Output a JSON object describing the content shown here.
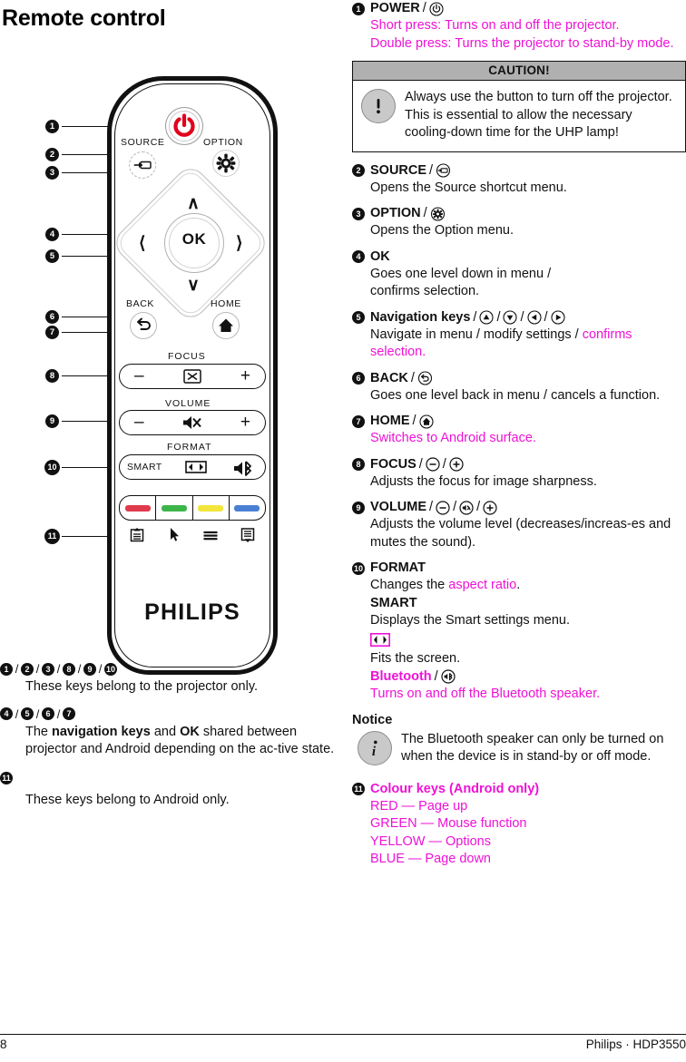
{
  "page": {
    "title": "Remote control",
    "footer_page_number": "8",
    "footer_brand": "Philips · HDP3550"
  },
  "colors": {
    "magenta": "#ee12d6",
    "caution_header_bg": "#b0b0b0",
    "key_red": "#e03a4e",
    "key_green": "#3cb54a",
    "key_yellow": "#f2e63c",
    "key_blue": "#4a7fd4",
    "power_red": "#e1001a"
  },
  "remote": {
    "brand": "PHILIPS",
    "labels": {
      "source": "SOURCE",
      "option": "OPTION",
      "back": "BACK",
      "home": "HOME",
      "focus": "FOCUS",
      "volume": "VOLUME",
      "format": "FORMAT",
      "smart": "SMART",
      "ok": "OK",
      "minus": "–",
      "plus": "+"
    },
    "callouts": [
      "1",
      "2",
      "3",
      "4",
      "5",
      "6",
      "7",
      "8",
      "9",
      "10",
      "11"
    ]
  },
  "legend": [
    {
      "numbers": [
        "1",
        "2",
        "3",
        "8",
        "9",
        "10"
      ],
      "text_parts": [
        {
          "t": "These keys belong to the projector only.",
          "bold": false
        }
      ]
    },
    {
      "numbers": [
        "4",
        "5",
        "6",
        "7"
      ],
      "text_parts": [
        {
          "t": "The ",
          "bold": false
        },
        {
          "t": "navigation keys",
          "bold": true
        },
        {
          "t": " and ",
          "bold": false
        },
        {
          "t": "OK",
          "bold": true
        },
        {
          "t": " shared between projector and Android depending on the ac-tive state.",
          "bold": false
        }
      ]
    },
    {
      "numbers": [
        "11"
      ],
      "text_parts": [
        {
          "t": "These keys belong to Android only.",
          "bold": false
        }
      ]
    }
  ],
  "items": [
    {
      "num": "1",
      "title": "POWER",
      "icon": "power-icon",
      "lines": [
        {
          "t": "Short press: Turns on and off the projector.",
          "magenta": true
        },
        {
          "t": "Double press: Turns the projector to stand-by mode.",
          "magenta": true
        }
      ]
    },
    {
      "num": "2",
      "title": "SOURCE",
      "icon": "source-icon",
      "lines": [
        {
          "t": "Opens the Source shortcut menu.",
          "magenta": false
        }
      ]
    },
    {
      "num": "3",
      "title": "OPTION",
      "icon": "gear-icon",
      "lines": [
        {
          "t": "Opens the Option menu.",
          "magenta": false
        }
      ]
    },
    {
      "num": "4",
      "title": "OK",
      "icon": null,
      "lines": [
        {
          "t": "Goes one level down in menu / confirms selection.",
          "magenta": false
        }
      ]
    },
    {
      "num": "5",
      "title": "Navigation keys",
      "icon": "arrow-keys-icon",
      "title_bold_style": "mixed",
      "lines": [
        {
          "t": "Navigate in menu / modify settings / ",
          "magenta": false,
          "inline": true
        },
        {
          "t": "confirms selection.",
          "magenta": true,
          "inline": true
        }
      ]
    },
    {
      "num": "6",
      "title": "BACK",
      "icon": "back-icon",
      "lines": [
        {
          "t": "Goes one level back in menu / cancels a function.",
          "magenta": false
        }
      ]
    },
    {
      "num": "7",
      "title": "HOME",
      "icon": "home-icon",
      "lines": [
        {
          "t": "Switches to Android surface.",
          "magenta": true
        }
      ]
    },
    {
      "num": "8",
      "title": "FOCUS",
      "icon": "minus-plus-icon",
      "lines": [
        {
          "t": "Adjusts the focus for image sharpness.",
          "magenta": false
        }
      ]
    },
    {
      "num": "9",
      "title": "VOLUME",
      "icon": "minus-mute-plus-icon",
      "lines": [
        {
          "t": "Adjusts the volume level (decreases/increas-es and mutes the sound).",
          "magenta": false
        }
      ]
    }
  ],
  "format_item": {
    "num": "10",
    "title": "FORMAT",
    "changes_prefix": "Changes the ",
    "changes_link": "aspect ratio",
    "changes_suffix": ".",
    "smart_title": "SMART",
    "smart_text": "Displays the Smart settings menu.",
    "fits_text": "Fits the screen.",
    "bluetooth_title": "Bluetooth",
    "bluetooth_text": "Turns on and off the Bluetooth speaker."
  },
  "caution": {
    "title": "CAUTION!",
    "icon": "exclamation-icon",
    "text": "Always use the        button to turn off the projector. This is essential to allow the necessary cooling-down time for the UHP lamp!"
  },
  "notice": {
    "title": "Notice",
    "icon": "info-icon",
    "text": "The Bluetooth speaker can only be turned on when the device is in stand-by or off mode."
  },
  "colour_keys": {
    "num": "11",
    "title": "Colour keys (Android only)",
    "rows": [
      "RED — Page up",
      "GREEN — Mouse function",
      "YELLOW — Options",
      "BLUE — Page down"
    ]
  }
}
